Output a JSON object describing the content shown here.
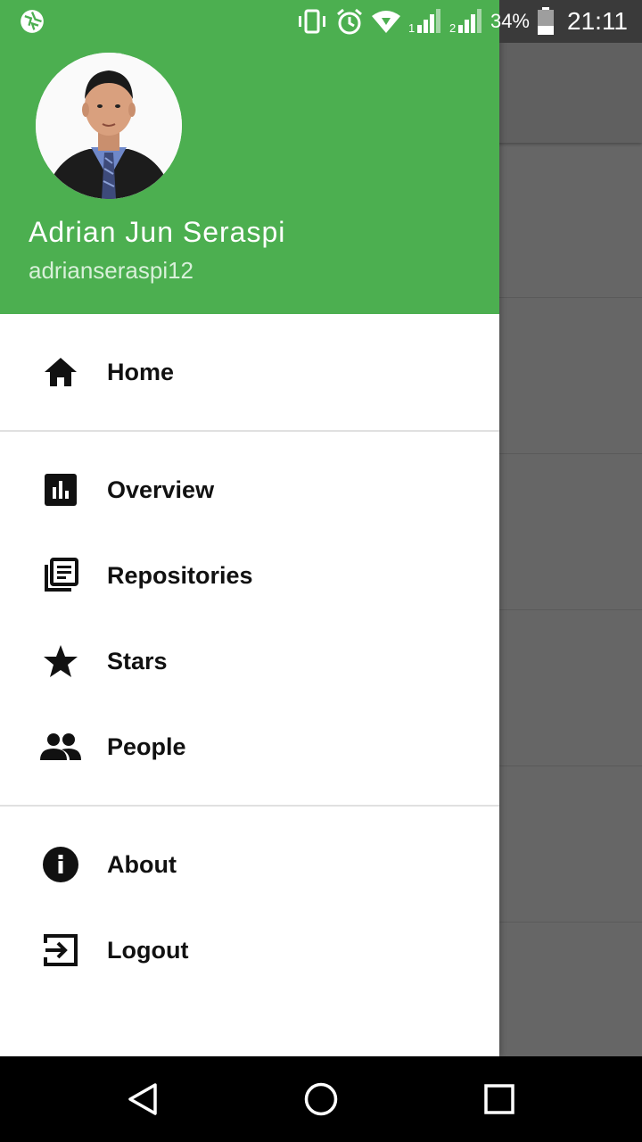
{
  "status_bar": {
    "battery": "34%",
    "time": "21:11",
    "sim1": "1",
    "sim2": "2"
  },
  "user": {
    "name": "Adrian Jun Seraspi",
    "handle": "adrianseraspi12"
  },
  "menu": {
    "home": "Home",
    "overview": "Overview",
    "repositories": "Repositories",
    "stars": "Stars",
    "people": "People",
    "about": "About",
    "logout": "Logout"
  },
  "colors": {
    "header": "#4caf50",
    "scrim": "#666666"
  },
  "icons": [
    "aperture-icon",
    "vibrate-icon",
    "alarm-icon",
    "wifi-icon",
    "signal-icon",
    "battery-icon",
    "home-icon",
    "chart-icon",
    "repo-icon",
    "star-icon",
    "people-icon",
    "info-icon",
    "logout-icon",
    "back-icon",
    "home-circle-icon",
    "recents-icon"
  ]
}
